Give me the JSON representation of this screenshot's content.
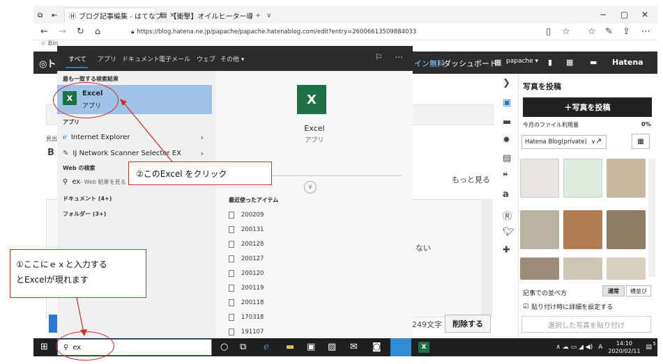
{
  "browser": {
    "tab1_title": "ブログ記事編集 - はてなブ",
    "tab2_title": "【衝撃】オイルヒーター導入後の電",
    "new_tab": "+",
    "tab_list": "∨",
    "min": "−",
    "max": "▢",
    "close": "✕",
    "url": "https://blog.hatena.ne.jp/papache/papache.hatenablog.com/edit?entry=26006613509884033",
    "fav_partial": "☆ Bin"
  },
  "hatena": {
    "logo": "◎ト",
    "ad_label": "イン無料",
    "dashboard": "ダッシュボード",
    "user": "papache ▾",
    "brand": "Hatena"
  },
  "editor": {
    "more": "もっと見る",
    "char_count": "249文字",
    "delete_label": "削除する",
    "partial_text": "ない",
    "left_frag1": "見出",
    "left_frag2": "B"
  },
  "photos": {
    "title": "写真を投稿",
    "post_button": "＋写真を投稿",
    "usage_label": "今月のファイル利用量",
    "usage_value": "0%",
    "album": "Hatena Blog(private)",
    "sort_label": "記事での並べ方",
    "sort_normal": "通常",
    "sort_side": "横並び",
    "detail_check": "貼り付け時に詳細を設定する",
    "paste_button": "選択した写真を貼り付け"
  },
  "start_menu": {
    "tabs": [
      "すべて",
      "アプリ",
      "ドキュメント",
      "電子メール",
      "ウェブ",
      "その他 ▾"
    ],
    "best_match_head": "最も一致する検索結果",
    "best_name": "Excel",
    "best_type": "アプリ",
    "apps_head": "アプリ",
    "app1": "Internet Explorer",
    "app2": "IJ Network Scanner Selector EX",
    "web_head": "Web の検索",
    "web_item": "ex",
    "web_hint": " - Web 結果を見る",
    "docs_head": "ドキュメント (4+)",
    "folders_head": "フォルダー (3+)",
    "detail_name": "Excel",
    "detail_type": "アプリ",
    "recent_head": "最近使ったアイテム",
    "recent": [
      "200209",
      "200131",
      "200128",
      "200127",
      "200120",
      "200119",
      "200118",
      "170318",
      "191107"
    ]
  },
  "annotations": {
    "step2": "②このExcel をクリック",
    "step1_line1": "①ここにｅｘと入力する",
    "step1_line2": "とExcelが現れます"
  },
  "taskbar": {
    "search_text": "ex",
    "time": "14:10",
    "date": "2020/02/11",
    "ime": "A",
    "notif": "5"
  },
  "colors": {
    "annotation_red": "#d62828",
    "excel_green": "#1e7145",
    "selection_blue": "#9ec3e6",
    "hatena_dark": "#2d2d2d"
  }
}
